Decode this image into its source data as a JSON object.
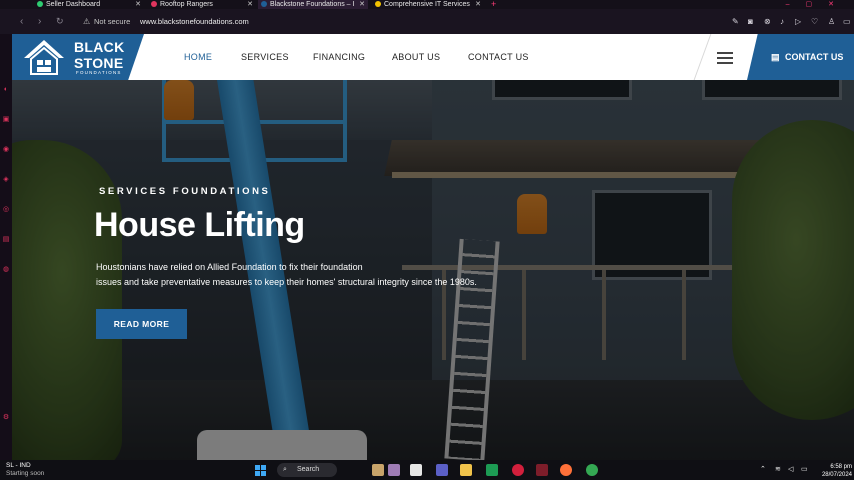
{
  "browser": {
    "tabs": [
      {
        "title": "Seller Dashboard",
        "favicon_color": "#2ecc71",
        "active": false
      },
      {
        "title": "Rooftop Rangers",
        "favicon_color": "#e0345e",
        "active": false
      },
      {
        "title": "Blackstone Foundations – I",
        "favicon_color": "#1f5f96",
        "active": true
      },
      {
        "title": "Comprehensive IT Services",
        "favicon_color": "#f2c200",
        "active": false
      }
    ],
    "security_label": "Not secure",
    "url": "www.blackstonefoundations.com"
  },
  "site": {
    "brand": {
      "line1": "BLACK",
      "line2": "STONE",
      "sub": "FOUNDATIONS"
    },
    "nav": [
      {
        "label": "HOME",
        "active": true
      },
      {
        "label": "SERVICES",
        "active": false
      },
      {
        "label": "FINANCING",
        "active": false
      },
      {
        "label": "ABOUT US",
        "active": false
      },
      {
        "label": "CONTACT US",
        "active": false
      }
    ],
    "contact_button": "CONTACT US",
    "hero": {
      "eyebrow": "SERVICES FOUNDATIONS",
      "title": "House Lifting",
      "description_line1": "Houstonians have relied on Allied Foundation to fix their foundation",
      "description_line2": "issues and take preventative measures to keep their homes' structural integrity since the 1980s.",
      "cta": "READ MORE"
    },
    "colors": {
      "brand_blue": "#1f5f96"
    }
  },
  "taskbar": {
    "weather_title": "SL - IND",
    "weather_sub": "Starting soon",
    "search_label": "Search",
    "time": "6:58 pm",
    "date": "28/07/2024"
  }
}
